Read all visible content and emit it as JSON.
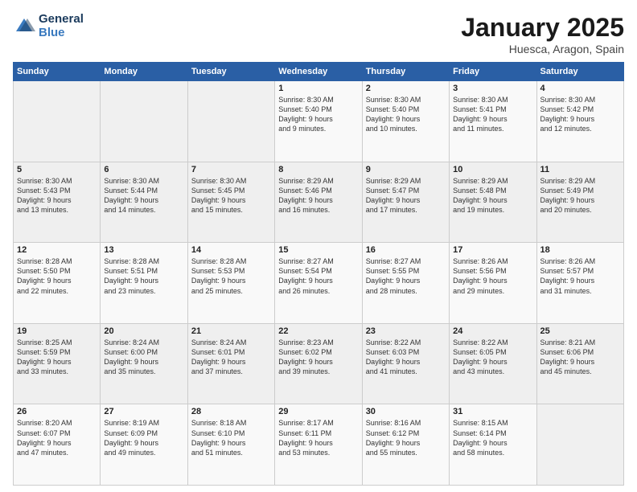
{
  "logo": {
    "line1": "General",
    "line2": "Blue"
  },
  "title": "January 2025",
  "subtitle": "Huesca, Aragon, Spain",
  "days_header": [
    "Sunday",
    "Monday",
    "Tuesday",
    "Wednesday",
    "Thursday",
    "Friday",
    "Saturday"
  ],
  "weeks": [
    [
      {
        "day": "",
        "content": ""
      },
      {
        "day": "",
        "content": ""
      },
      {
        "day": "",
        "content": ""
      },
      {
        "day": "1",
        "content": "Sunrise: 8:30 AM\nSunset: 5:40 PM\nDaylight: 9 hours\nand 9 minutes."
      },
      {
        "day": "2",
        "content": "Sunrise: 8:30 AM\nSunset: 5:40 PM\nDaylight: 9 hours\nand 10 minutes."
      },
      {
        "day": "3",
        "content": "Sunrise: 8:30 AM\nSunset: 5:41 PM\nDaylight: 9 hours\nand 11 minutes."
      },
      {
        "day": "4",
        "content": "Sunrise: 8:30 AM\nSunset: 5:42 PM\nDaylight: 9 hours\nand 12 minutes."
      }
    ],
    [
      {
        "day": "5",
        "content": "Sunrise: 8:30 AM\nSunset: 5:43 PM\nDaylight: 9 hours\nand 13 minutes."
      },
      {
        "day": "6",
        "content": "Sunrise: 8:30 AM\nSunset: 5:44 PM\nDaylight: 9 hours\nand 14 minutes."
      },
      {
        "day": "7",
        "content": "Sunrise: 8:30 AM\nSunset: 5:45 PM\nDaylight: 9 hours\nand 15 minutes."
      },
      {
        "day": "8",
        "content": "Sunrise: 8:29 AM\nSunset: 5:46 PM\nDaylight: 9 hours\nand 16 minutes."
      },
      {
        "day": "9",
        "content": "Sunrise: 8:29 AM\nSunset: 5:47 PM\nDaylight: 9 hours\nand 17 minutes."
      },
      {
        "day": "10",
        "content": "Sunrise: 8:29 AM\nSunset: 5:48 PM\nDaylight: 9 hours\nand 19 minutes."
      },
      {
        "day": "11",
        "content": "Sunrise: 8:29 AM\nSunset: 5:49 PM\nDaylight: 9 hours\nand 20 minutes."
      }
    ],
    [
      {
        "day": "12",
        "content": "Sunrise: 8:28 AM\nSunset: 5:50 PM\nDaylight: 9 hours\nand 22 minutes."
      },
      {
        "day": "13",
        "content": "Sunrise: 8:28 AM\nSunset: 5:51 PM\nDaylight: 9 hours\nand 23 minutes."
      },
      {
        "day": "14",
        "content": "Sunrise: 8:28 AM\nSunset: 5:53 PM\nDaylight: 9 hours\nand 25 minutes."
      },
      {
        "day": "15",
        "content": "Sunrise: 8:27 AM\nSunset: 5:54 PM\nDaylight: 9 hours\nand 26 minutes."
      },
      {
        "day": "16",
        "content": "Sunrise: 8:27 AM\nSunset: 5:55 PM\nDaylight: 9 hours\nand 28 minutes."
      },
      {
        "day": "17",
        "content": "Sunrise: 8:26 AM\nSunset: 5:56 PM\nDaylight: 9 hours\nand 29 minutes."
      },
      {
        "day": "18",
        "content": "Sunrise: 8:26 AM\nSunset: 5:57 PM\nDaylight: 9 hours\nand 31 minutes."
      }
    ],
    [
      {
        "day": "19",
        "content": "Sunrise: 8:25 AM\nSunset: 5:59 PM\nDaylight: 9 hours\nand 33 minutes."
      },
      {
        "day": "20",
        "content": "Sunrise: 8:24 AM\nSunset: 6:00 PM\nDaylight: 9 hours\nand 35 minutes."
      },
      {
        "day": "21",
        "content": "Sunrise: 8:24 AM\nSunset: 6:01 PM\nDaylight: 9 hours\nand 37 minutes."
      },
      {
        "day": "22",
        "content": "Sunrise: 8:23 AM\nSunset: 6:02 PM\nDaylight: 9 hours\nand 39 minutes."
      },
      {
        "day": "23",
        "content": "Sunrise: 8:22 AM\nSunset: 6:03 PM\nDaylight: 9 hours\nand 41 minutes."
      },
      {
        "day": "24",
        "content": "Sunrise: 8:22 AM\nSunset: 6:05 PM\nDaylight: 9 hours\nand 43 minutes."
      },
      {
        "day": "25",
        "content": "Sunrise: 8:21 AM\nSunset: 6:06 PM\nDaylight: 9 hours\nand 45 minutes."
      }
    ],
    [
      {
        "day": "26",
        "content": "Sunrise: 8:20 AM\nSunset: 6:07 PM\nDaylight: 9 hours\nand 47 minutes."
      },
      {
        "day": "27",
        "content": "Sunrise: 8:19 AM\nSunset: 6:09 PM\nDaylight: 9 hours\nand 49 minutes."
      },
      {
        "day": "28",
        "content": "Sunrise: 8:18 AM\nSunset: 6:10 PM\nDaylight: 9 hours\nand 51 minutes."
      },
      {
        "day": "29",
        "content": "Sunrise: 8:17 AM\nSunset: 6:11 PM\nDaylight: 9 hours\nand 53 minutes."
      },
      {
        "day": "30",
        "content": "Sunrise: 8:16 AM\nSunset: 6:12 PM\nDaylight: 9 hours\nand 55 minutes."
      },
      {
        "day": "31",
        "content": "Sunrise: 8:15 AM\nSunset: 6:14 PM\nDaylight: 9 hours\nand 58 minutes."
      },
      {
        "day": "",
        "content": ""
      }
    ]
  ]
}
